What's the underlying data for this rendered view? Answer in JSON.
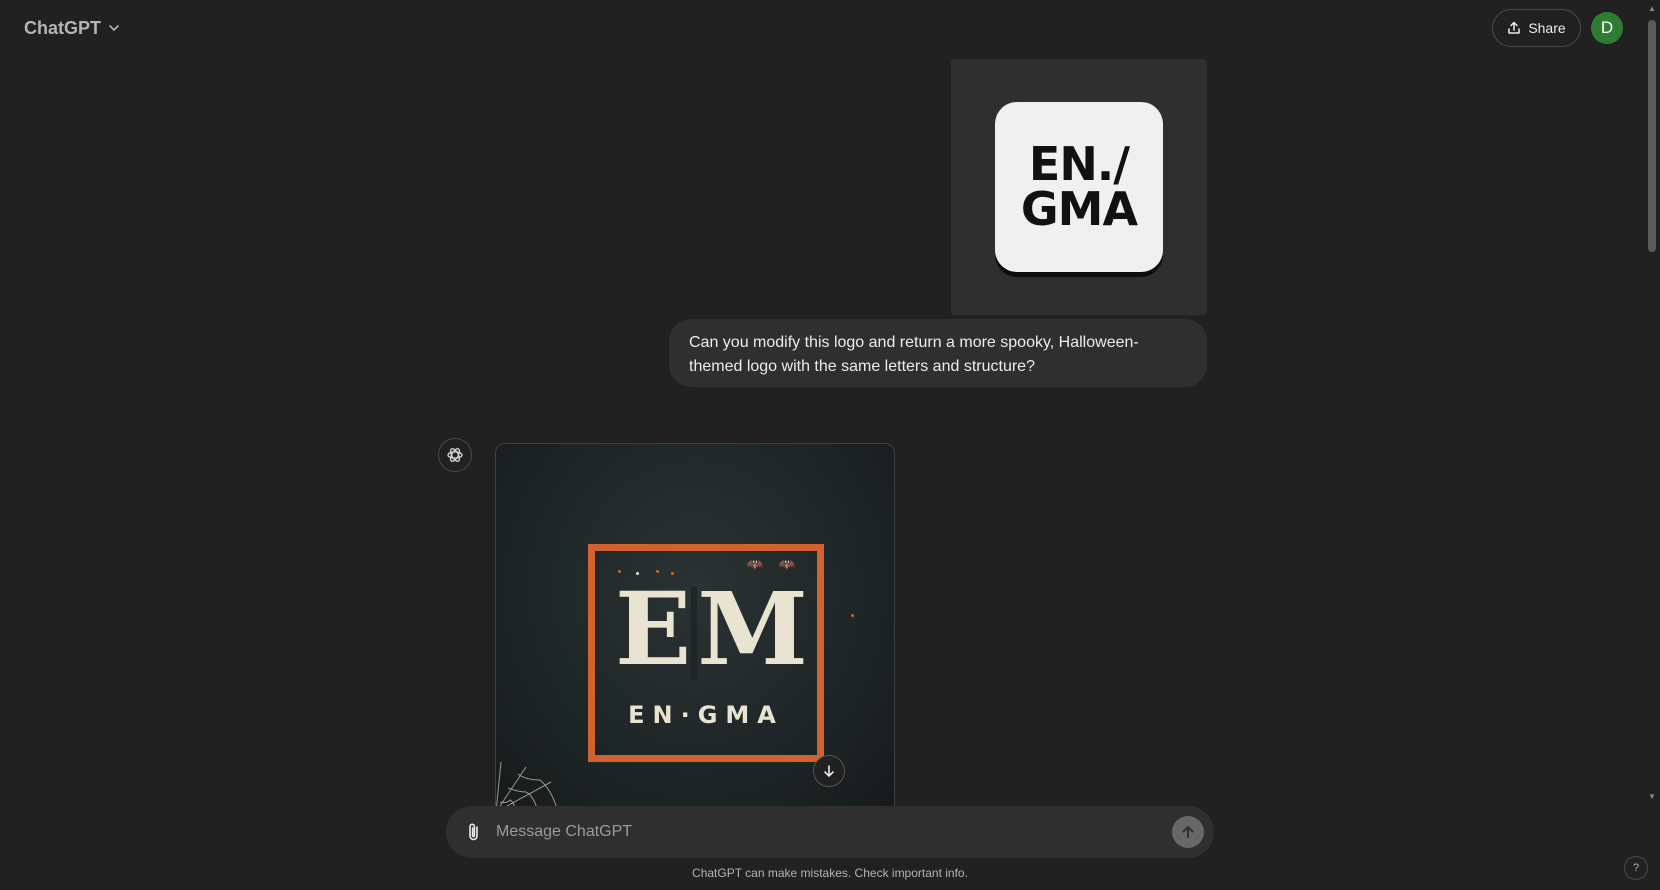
{
  "header": {
    "model_name": "ChatGPT",
    "share_label": "Share",
    "avatar_initial": "D"
  },
  "conversation": {
    "user_image": {
      "logo_lines": [
        "EN./",
        "GMA"
      ]
    },
    "user_message": "Can you modify this logo and return a more spooky, Halloween-themed logo with the same letters and structure?",
    "assistant_image": {
      "big_letters": "EM",
      "sub_text": "EN·GMA"
    }
  },
  "composer": {
    "placeholder": "Message ChatGPT",
    "disclaimer": "ChatGPT can make mistakes. Check important info."
  },
  "help": {
    "label": "?"
  },
  "colors": {
    "background": "#212121",
    "bubble": "#2f2f2f",
    "avatar": "#2e7d32",
    "spooky_orange": "#d2622f"
  }
}
